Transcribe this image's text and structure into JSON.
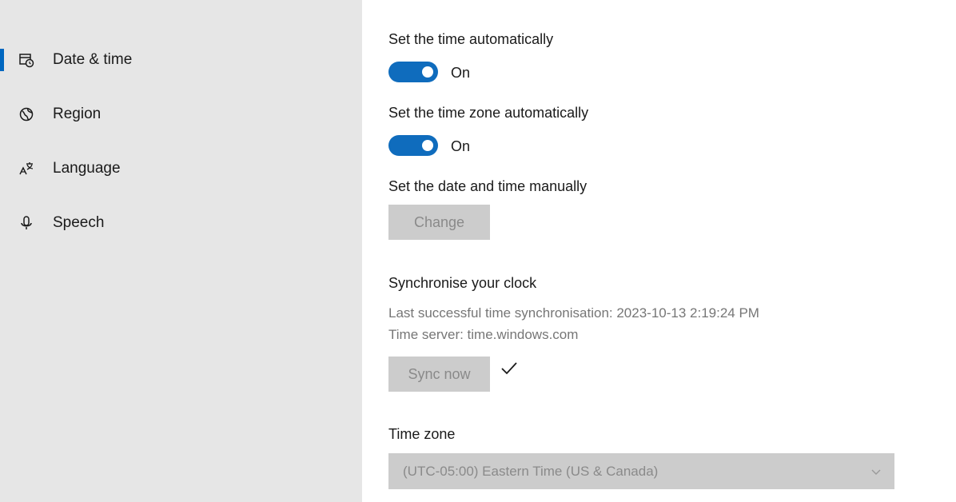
{
  "sidebar": {
    "items": [
      {
        "label": "Date & time",
        "icon": "calendar-clock-icon",
        "selected": true
      },
      {
        "label": "Region",
        "icon": "globe-icon",
        "selected": false
      },
      {
        "label": "Language",
        "icon": "language-icon",
        "selected": false
      },
      {
        "label": "Speech",
        "icon": "microphone-icon",
        "selected": false
      }
    ]
  },
  "settings": {
    "auto_time_label": "Set the time automatically",
    "auto_time_state": "On",
    "auto_timezone_label": "Set the time zone automatically",
    "auto_timezone_state": "On",
    "manual_label": "Set the date and time manually",
    "change_button": "Change",
    "sync_heading": "Synchronise your clock",
    "last_sync": "Last successful time synchronisation: 2023-10-13 2:19:24 PM",
    "time_server": "Time server: time.windows.com",
    "sync_button": "Sync now",
    "timezone_label": "Time zone",
    "timezone_value": "(UTC-05:00) Eastern Time (US & Canada)"
  },
  "colors": {
    "accent": "#0f6cbd",
    "sidebar_bg": "#e6e6e6",
    "disabled_bg": "#cccccc"
  }
}
